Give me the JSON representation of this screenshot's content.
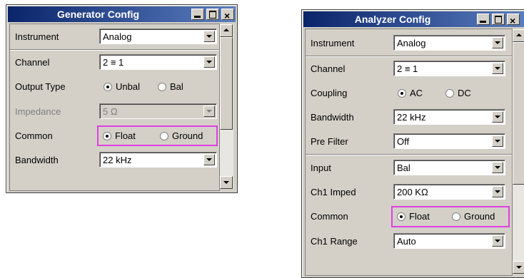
{
  "generator": {
    "title": "Generator Config",
    "rows": {
      "instrument": {
        "label": "Instrument",
        "value": "Analog"
      },
      "channel": {
        "label": "Channel",
        "value": "2 ≡ 1"
      },
      "output_type": {
        "label": "Output Type",
        "opt1": "Unbal",
        "opt2": "Bal",
        "selected": "Unbal"
      },
      "impedance": {
        "label": "Impedance",
        "value": "5 Ω"
      },
      "common": {
        "label": "Common",
        "opt1": "Float",
        "opt2": "Ground",
        "selected": "Float"
      },
      "bandwidth": {
        "label": "Bandwidth",
        "value": "22 kHz"
      }
    }
  },
  "analyzer": {
    "title": "Analyzer Config",
    "rows": {
      "instrument": {
        "label": "Instrument",
        "value": "Analog"
      },
      "channel": {
        "label": "Channel",
        "value": "2 ≡ 1"
      },
      "coupling": {
        "label": "Coupling",
        "opt1": "AC",
        "opt2": "DC",
        "selected": "AC"
      },
      "bandwidth": {
        "label": "Bandwidth",
        "value": "22 kHz"
      },
      "pre_filter": {
        "label": "Pre Filter",
        "value": "Off"
      },
      "input": {
        "label": "Input",
        "value": "Bal"
      },
      "ch1_imped": {
        "label": "Ch1 Imped",
        "value": "200 KΩ"
      },
      "common": {
        "label": "Common",
        "opt1": "Float",
        "opt2": "Ground",
        "selected": "Float"
      },
      "ch1_range": {
        "label": "Ch1 Range",
        "value": "Auto"
      }
    }
  },
  "colors": {
    "titlebar": "#0a246a",
    "highlight": "#e040e0",
    "panel": "#d4d0c8"
  },
  "icons": [
    "minimize-icon",
    "maximize-icon",
    "close-icon",
    "scroll-up-icon",
    "scroll-down-icon",
    "dropdown-arrow-icon",
    "radio-icon"
  ]
}
